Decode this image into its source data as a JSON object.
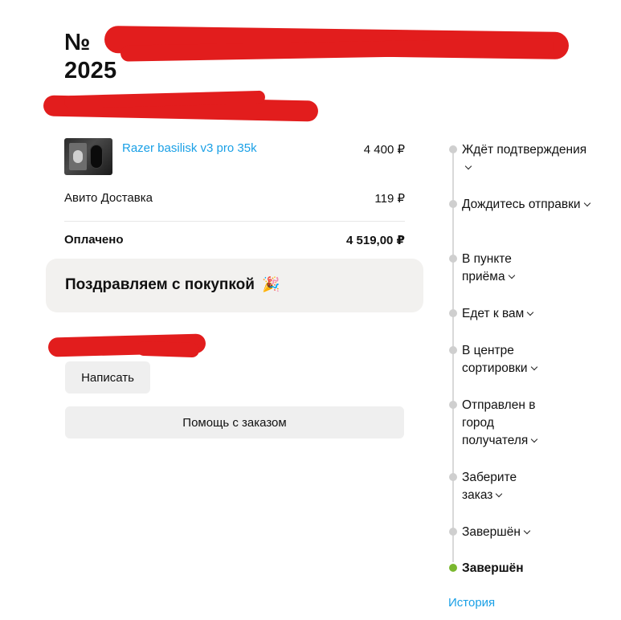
{
  "order": {
    "title_prefix": "№",
    "title_year": "2025"
  },
  "item": {
    "name": "Razer basilisk v3 pro 35k",
    "price": "4 400 ₽"
  },
  "delivery": {
    "label": "Авито Доставка",
    "price": "119 ₽"
  },
  "paid": {
    "label": "Оплачено",
    "total": "4 519,00 ₽"
  },
  "congrats": {
    "text": "Поздравляем с покупкой",
    "emoji": "🎉"
  },
  "buttons": {
    "write": "Написать",
    "help": "Помощь с заказом"
  },
  "timeline": {
    "steps": [
      {
        "label": "Ждёт подтверждения"
      },
      {
        "label": "Дождитесь отправки"
      },
      {
        "label": "В пункте приёма"
      },
      {
        "label": "Едет к вам"
      },
      {
        "label": "В центре сортировки"
      },
      {
        "label": "Отправлен в город получателя"
      },
      {
        "label": "Заберите заказ"
      },
      {
        "label": "Завершён"
      },
      {
        "label": "Завершён"
      }
    ],
    "history_link": "История"
  },
  "colors": {
    "accent_link": "#1aa0e6",
    "redaction": "#e21d1d",
    "status_done": "#7ab82f",
    "status_pending": "#cfcfcf"
  }
}
